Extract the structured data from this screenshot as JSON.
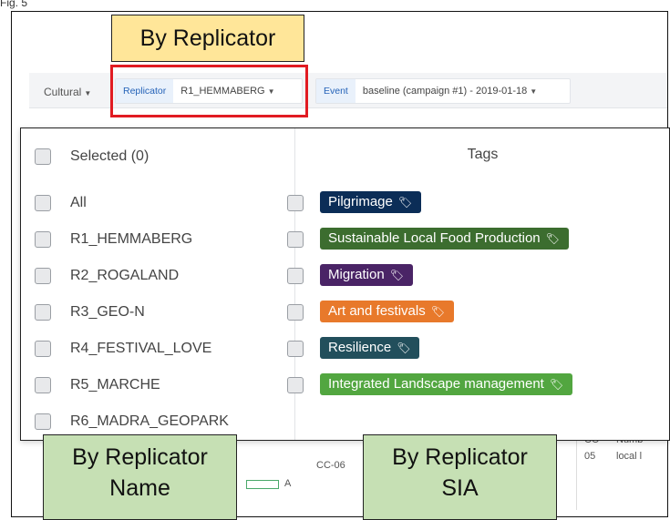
{
  "page": {
    "top_text": "Fig. 5"
  },
  "toolbar": {
    "cultural_label": "Cultural",
    "replicator_tag": "Replicator",
    "replicator_value": "R1_HEMMABERG",
    "event_tag": "Event",
    "event_value": "baseline (campaign #1) - 2019-01-18"
  },
  "callouts": {
    "top": "By Replicator",
    "name_line1": "By Replicator",
    "name_line2": "Name",
    "sia_line1": "By Replicator",
    "sia_line2": "SIA"
  },
  "dropdown": {
    "selected_label": "Selected (0)",
    "tags_title": "Tags",
    "replicators": [
      "All",
      "R1_HEMMABERG",
      "R2_ROGALAND",
      "R3_GEO-N",
      "R4_FESTIVAL_LOVE",
      "R5_MARCHE",
      "R6_MADRA_GEOPARK"
    ],
    "tags": [
      {
        "label": "Pilgrimage",
        "color": "#0b2d57"
      },
      {
        "label": "Sustainable Local Food Production",
        "color": "#3c6d2f"
      },
      {
        "label": "Migration",
        "color": "#4a2466"
      },
      {
        "label": "Art and festivals",
        "color": "#e8792b"
      },
      {
        "label": "Resilience",
        "color": "#224f5c"
      },
      {
        "label": "Integrated Landscape management",
        "color": "#52a640"
      }
    ]
  },
  "background": {
    "cc06": "CC-06",
    "cc05a": "CC-",
    "cc05b": "05",
    "numb": "Numb",
    "local": "local l",
    "legend_a": "A"
  },
  "colors": {
    "accent_blue": "#2563b8",
    "highlight_red": "#e11b22",
    "callout_yellow": "#ffe699",
    "callout_green": "#c6e0b4"
  }
}
